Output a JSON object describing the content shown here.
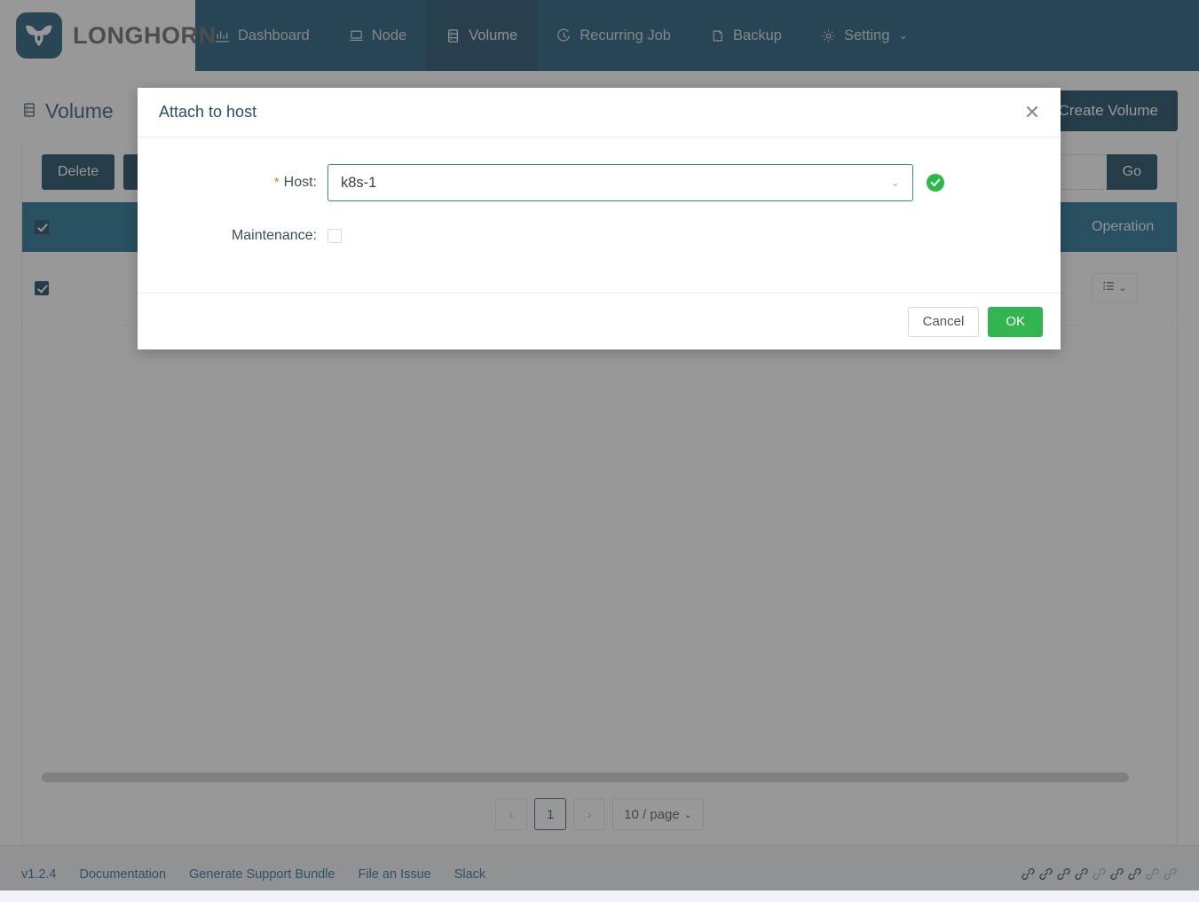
{
  "brand": {
    "name": "LONGHORN",
    "logo_icon": "bull-head-icon"
  },
  "nav": {
    "items": [
      {
        "label": "Dashboard",
        "icon": "bar-chart-icon",
        "active": false
      },
      {
        "label": "Node",
        "icon": "laptop-icon",
        "active": false
      },
      {
        "label": "Volume",
        "icon": "database-stack-icon",
        "active": true
      },
      {
        "label": "Recurring Job",
        "icon": "clock-icon",
        "active": false
      },
      {
        "label": "Backup",
        "icon": "archive-box-icon",
        "active": false
      },
      {
        "label": "Setting",
        "icon": "gear-icon",
        "active": false,
        "caret": "⌄"
      }
    ]
  },
  "page": {
    "title": "Volume",
    "title_icon": "database-stack-icon",
    "create_volume_label": "Create Volume",
    "toolbar": {
      "delete_label": "Delete",
      "second_button_label": "",
      "search_placeholder": "",
      "go_label": "Go"
    },
    "table": {
      "columns": [
        "",
        "",
        "Operation"
      ],
      "header_checkbox_checked": true,
      "rows": [
        {
          "checked": true,
          "operation_icon": "list-icon",
          "operation_caret": "⌄"
        }
      ]
    },
    "pagination": {
      "prev": "‹",
      "current": "1",
      "next": "›",
      "page_size": "10 / page",
      "page_size_caret": "⌄"
    }
  },
  "modal": {
    "title": "Attach to host",
    "close_icon": "close-icon",
    "host_label": "Host:",
    "host_required_mark": "*",
    "host_value": "k8s-1",
    "host_caret": "⌄",
    "host_valid_icon": "check-circle-icon",
    "maintenance_label": "Maintenance:",
    "maintenance_checked": false,
    "cancel_label": "Cancel",
    "ok_label": "OK"
  },
  "footer": {
    "links": [
      {
        "label": "v1.2.4"
      },
      {
        "label": "Documentation"
      },
      {
        "label": "Generate Support Bundle"
      },
      {
        "label": "File an Issue"
      },
      {
        "label": "Slack"
      }
    ],
    "chain_icons": [
      {
        "name": "chain-link-icon",
        "dim": false
      },
      {
        "name": "chain-link-icon",
        "dim": false
      },
      {
        "name": "chain-link-icon",
        "dim": false
      },
      {
        "name": "chain-link-icon",
        "dim": false
      },
      {
        "name": "chain-link-icon",
        "dim": true
      },
      {
        "name": "chain-link-icon",
        "dim": false
      },
      {
        "name": "chain-link-icon",
        "dim": false
      },
      {
        "name": "chain-link-icon",
        "dim": true
      },
      {
        "name": "chain-link-icon",
        "dim": true
      }
    ]
  },
  "colors": {
    "nav_bg": "#05486b",
    "nav_active_bg": "#083c5a",
    "primary_button": "#003350",
    "table_header": "#0a6184",
    "ok_green": "#32b550",
    "required_star": "#d4802a",
    "link_blue": "#15628a"
  }
}
